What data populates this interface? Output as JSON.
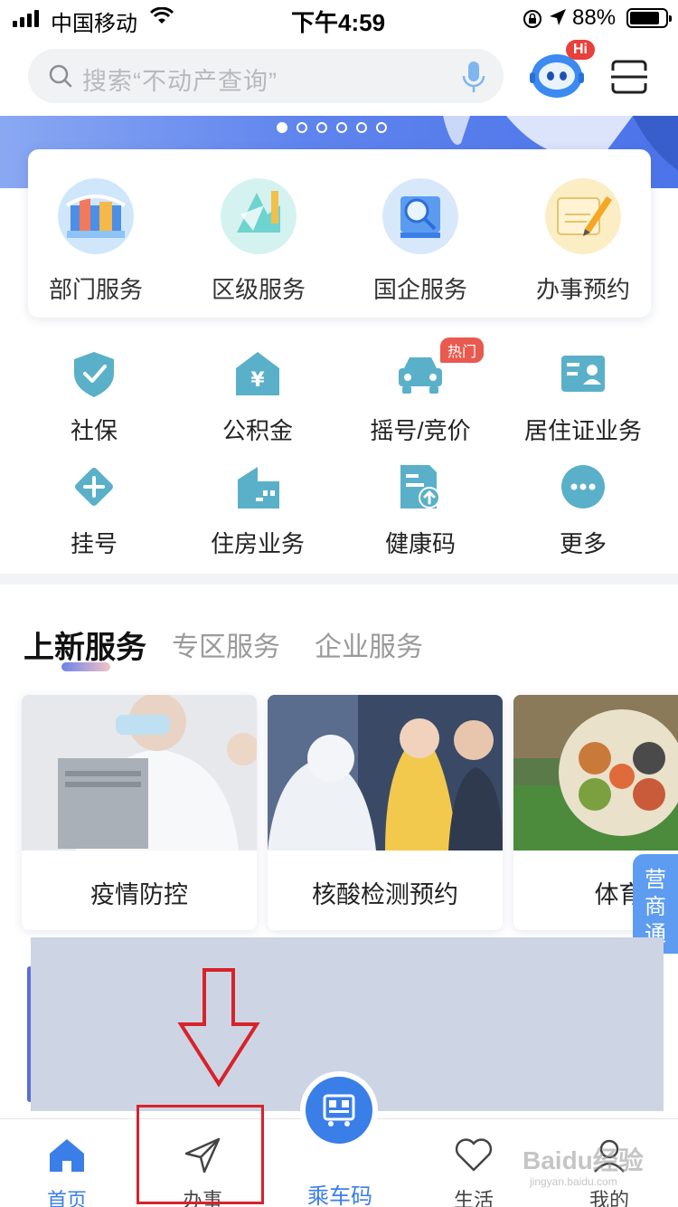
{
  "status_bar": {
    "carrier": "中国移动",
    "time": "下午4:59",
    "battery": "88%",
    "battery_level": 0.88
  },
  "search": {
    "placeholder": "搜索“不动产查询”"
  },
  "assistant": {
    "badge": "Hi"
  },
  "banner": {
    "dot_count": 6,
    "active_index": 0
  },
  "featured": [
    {
      "label": "部门服务",
      "icon": "department-icon"
    },
    {
      "label": "区级服务",
      "icon": "district-icon"
    },
    {
      "label": "国企服务",
      "icon": "state-enterprise-icon"
    },
    {
      "label": "办事预约",
      "icon": "appointment-icon"
    }
  ],
  "grid": [
    {
      "label": "社保",
      "icon": "shield-check-icon"
    },
    {
      "label": "公积金",
      "icon": "house-yuan-icon"
    },
    {
      "label": "摇号/竞价",
      "icon": "car-icon",
      "badge": "热门"
    },
    {
      "label": "居住证业务",
      "icon": "id-card-icon"
    },
    {
      "label": "挂号",
      "icon": "plus-diamond-icon"
    },
    {
      "label": "住房业务",
      "icon": "building-icon"
    },
    {
      "label": "健康码",
      "icon": "health-code-icon"
    },
    {
      "label": "更多",
      "icon": "more-icon"
    }
  ],
  "service_tabs": {
    "active": "上新服务",
    "others": [
      "专区服务",
      "企业服务"
    ]
  },
  "service_cards": [
    {
      "label": "疫情防控",
      "icon": "doctor-photo"
    },
    {
      "label": "核酸检测预约",
      "icon": "nucleic-test-photo"
    },
    {
      "label": "体育场",
      "icon": "stadium-photo"
    }
  ],
  "side_tab": {
    "label": "营商通"
  },
  "bottom_nav": {
    "home": "首页",
    "affairs": "办事",
    "ride": "乘车码",
    "life": "生活",
    "mine": "我的"
  },
  "colors": {
    "accent": "#3a7ee8",
    "icon_teal": "#5ab0c8",
    "hot_badge": "#e85a4f",
    "annotation_red": "#d8222a"
  }
}
